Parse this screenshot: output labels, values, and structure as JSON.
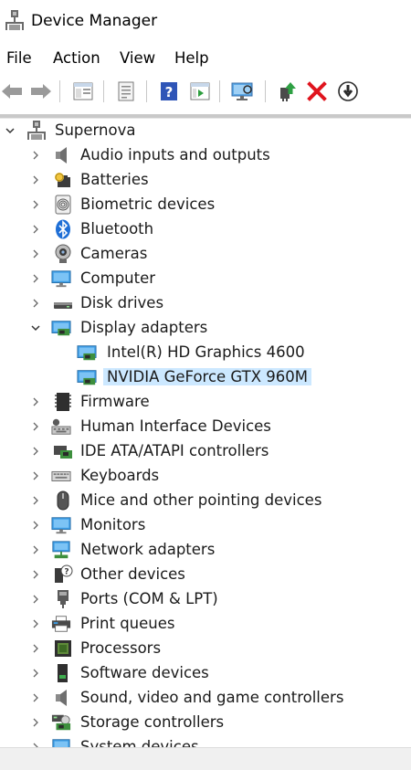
{
  "window": {
    "title": "Device Manager"
  },
  "menu": [
    "File",
    "Action",
    "View",
    "Help"
  ],
  "toolbar": {
    "buttons": [
      "back-icon",
      "forward-icon",
      "properties-panel-icon",
      "sheet-icon",
      "help-icon",
      "run-panel-icon",
      "monitor-scan-icon",
      "update-driver-icon",
      "uninstall-icon",
      "download-icon"
    ]
  },
  "tree": {
    "root": "Supernova",
    "categories": [
      "Audio inputs and outputs",
      "Batteries",
      "Biometric devices",
      "Bluetooth",
      "Cameras",
      "Computer",
      "Disk drives",
      "Display adapters",
      "Firmware",
      "Human Interface Devices",
      "IDE ATA/ATAPI controllers",
      "Keyboards",
      "Mice and other pointing devices",
      "Monitors",
      "Network adapters",
      "Other devices",
      "Ports (COM & LPT)",
      "Print queues",
      "Processors",
      "Software devices",
      "Sound, video and game controllers",
      "Storage controllers",
      "System devices"
    ],
    "display_children": [
      "Intel(R) HD Graphics 4600",
      "NVIDIA GeForce GTX 960M"
    ]
  },
  "colors": {
    "selection": "#cce8ff",
    "accent": "#0078d7",
    "uninstall_red": "#e0141e"
  }
}
